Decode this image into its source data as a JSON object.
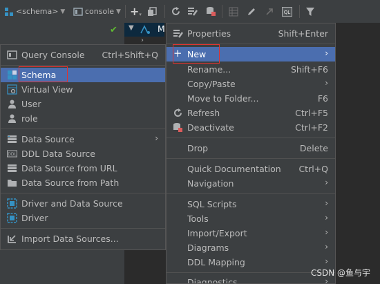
{
  "toolbar": {
    "schema_label": "<schema>",
    "console_label": "console"
  },
  "tree": {
    "root_label": "M"
  },
  "submenu": {
    "items": [
      {
        "label": "Query Console",
        "shortcut": "Ctrl+Shift+Q",
        "icon": "query-console-icon"
      },
      {
        "label": "Schema",
        "icon": "schema-icon"
      },
      {
        "label": "Virtual View",
        "icon": "virtual-view-icon"
      },
      {
        "label": "User",
        "icon": "user-icon"
      },
      {
        "label": "role",
        "icon": "role-icon"
      },
      {
        "label": "Data Source",
        "icon": "data-source-icon"
      },
      {
        "label": "DDL Data Source",
        "icon": "ddl-data-source-icon"
      },
      {
        "label": "Data Source from URL",
        "icon": "data-source-url-icon"
      },
      {
        "label": "Data Source from Path",
        "icon": "folder-icon"
      },
      {
        "label": "Driver and Data Source",
        "icon": "driver-and-data-source-icon"
      },
      {
        "label": "Driver",
        "icon": "driver-icon"
      },
      {
        "label": "Import Data Sources...",
        "icon": "import-icon"
      }
    ]
  },
  "context_menu": {
    "items": [
      {
        "label": "Properties",
        "shortcut": "Shift+Enter"
      },
      {
        "label": "New"
      },
      {
        "label": "Rename...",
        "shortcut": "Shift+F6"
      },
      {
        "label": "Copy/Paste"
      },
      {
        "label": "Move to Folder...",
        "shortcut": "F6"
      },
      {
        "label": "Refresh",
        "shortcut": "Ctrl+F5"
      },
      {
        "label": "Deactivate",
        "shortcut": "Ctrl+F2"
      },
      {
        "label": "Drop",
        "shortcut": "Delete"
      },
      {
        "label": "Quick Documentation",
        "shortcut": "Ctrl+Q"
      },
      {
        "label": "Navigation"
      },
      {
        "label": "SQL Scripts"
      },
      {
        "label": "Tools"
      },
      {
        "label": "Import/Export"
      },
      {
        "label": "Diagrams"
      },
      {
        "label": "DDL Mapping"
      },
      {
        "label": "Diagnostics"
      }
    ]
  },
  "watermark": "CSDN @鱼与宇",
  "colors": {
    "selection": "#4b6eaf",
    "menu_bg": "#3c3f41",
    "highlight_box": "#e0332f"
  }
}
